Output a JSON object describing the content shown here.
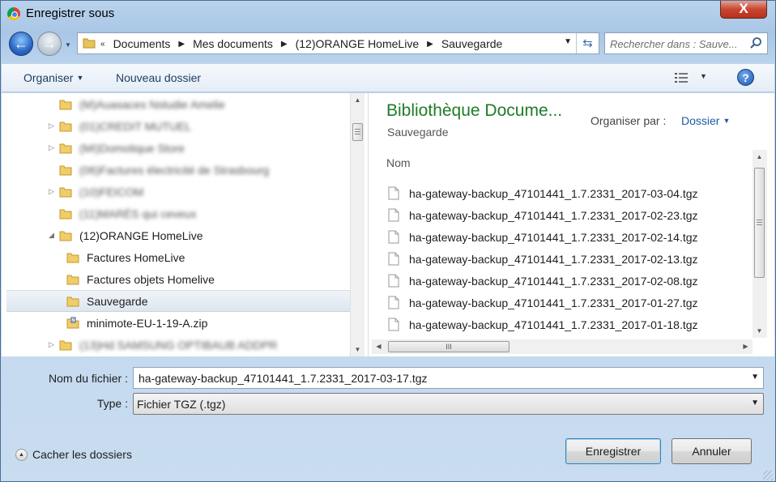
{
  "window": {
    "title": "Enregistrer sous",
    "close_label": "X"
  },
  "nav": {
    "crumb_overflow": "«",
    "breadcrumbs": [
      "Documents",
      "Mes documents",
      "(12)ORANGE HomeLive",
      "Sauvegarde"
    ],
    "search_placeholder": "Rechercher dans : Sauve..."
  },
  "toolbar": {
    "organize_label": "Organiser",
    "new_folder_label": "Nouveau dossier",
    "help_label": "?"
  },
  "tree": {
    "items": [
      {
        "label": "(M)Auasaces Nstudie Amelie",
        "blurred": true
      },
      {
        "label": "(01)CREDIT MUTUEL",
        "blurred": true
      },
      {
        "label": "(MI)Domotique Store",
        "blurred": true
      },
      {
        "label": "(06)Factures électricité de Strasbourg",
        "blurred": true
      },
      {
        "label": "(10)FEICOM",
        "blurred": true
      },
      {
        "label": "(11)MARÉS qui ceveux",
        "blurred": true
      },
      {
        "label": "(12)ORANGE HomeLive",
        "blurred": false
      },
      {
        "label": "Factures HomeLive",
        "blurred": false
      },
      {
        "label": "Factures objets Homelive",
        "blurred": false
      },
      {
        "label": "Sauvegarde",
        "blurred": false
      },
      {
        "label": "minimote-EU-1-19-A.zip",
        "blurred": false
      },
      {
        "label": "(13)Hd SAMSUNG OPTIBAUB ADDPR",
        "blurred": true
      }
    ]
  },
  "library": {
    "title": "Bibliothèque Docume...",
    "subtitle": "Sauvegarde",
    "arrange_label": "Organiser par :",
    "arrange_value": "Dossier",
    "column_header": "Nom",
    "files": [
      "ha-gateway-backup_47101441_1.7.2331_2017-03-04.tgz",
      "ha-gateway-backup_47101441_1.7.2331_2017-02-23.tgz",
      "ha-gateway-backup_47101441_1.7.2331_2017-02-14.tgz",
      "ha-gateway-backup_47101441_1.7.2331_2017-02-13.tgz",
      "ha-gateway-backup_47101441_1.7.2331_2017-02-08.tgz",
      "ha-gateway-backup_47101441_1.7.2331_2017-01-27.tgz",
      "ha-gateway-backup_47101441_1.7.2331_2017-01-18.tgz"
    ],
    "hscroll_grip": "III"
  },
  "form": {
    "filename_label": "Nom du fichier :",
    "filename_value": "ha-gateway-backup_47101441_1.7.2331_2017-03-17.tgz",
    "type_label": "Type :",
    "type_value": "Fichier TGZ (.tgz)",
    "hide_folders_label": "Cacher les dossiers",
    "save_label": "Enregistrer",
    "cancel_label": "Annuler"
  }
}
